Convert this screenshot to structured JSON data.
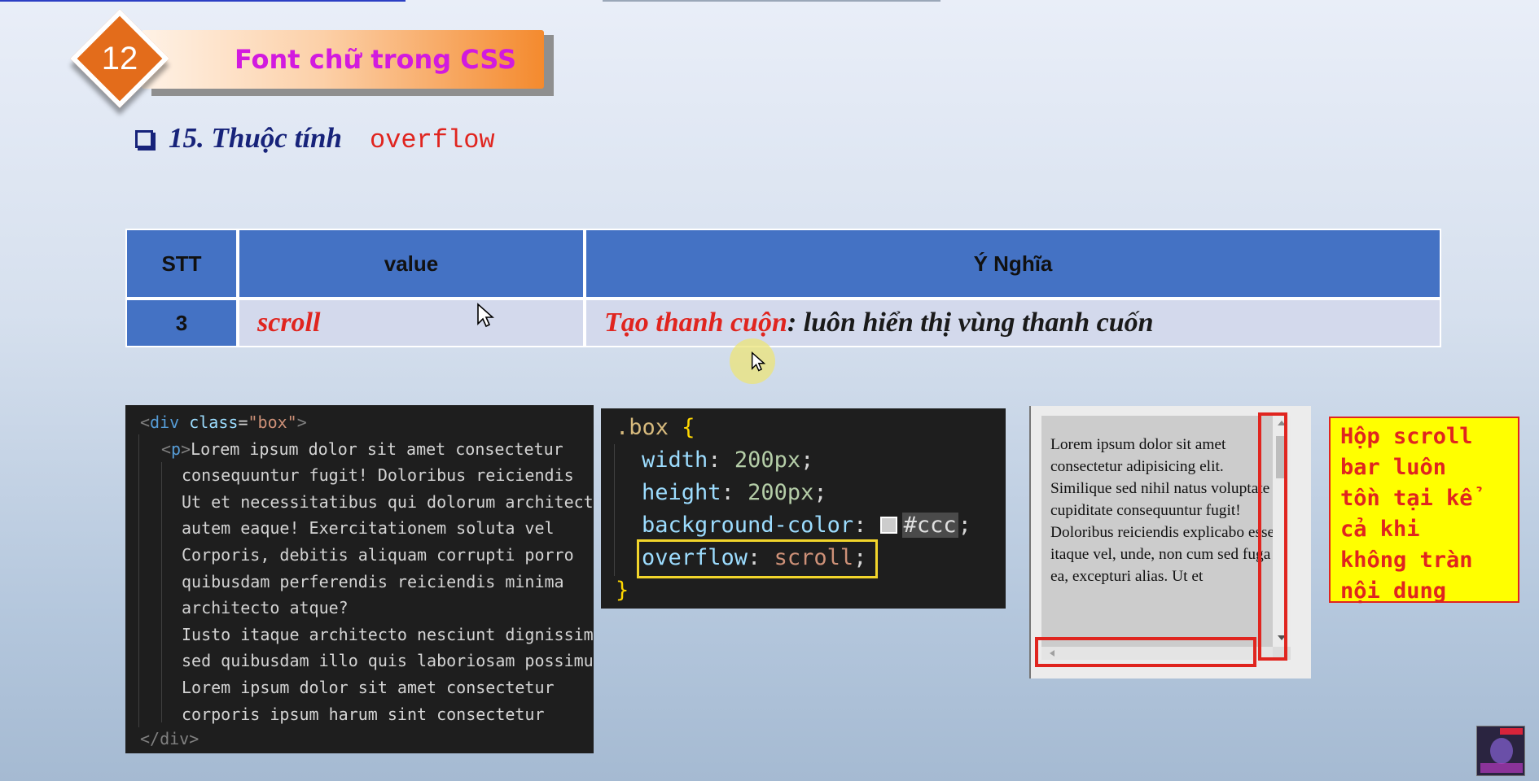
{
  "lesson": {
    "number": "12",
    "title": "Font chữ trong CSS"
  },
  "subheading": {
    "text": "15. Thuộc tính",
    "code": "overflow"
  },
  "table": {
    "headers": [
      "STT",
      "value",
      "Ý Nghĩa"
    ],
    "row": {
      "stt": "3",
      "value": "scroll",
      "meaning_highlight": "Tạo thanh cuộn",
      "meaning_rest": " : luôn hiển thị vùng thanh cuốn"
    }
  },
  "html_code": {
    "lines": [
      {
        "tag_open": "<",
        "tag": "div",
        "attr": "class",
        "eq": "=",
        "value": "\"box\"",
        "tag_close": ">"
      },
      {
        "tag_open": "<",
        "tag": "p",
        "tag_close": ">",
        "text": "Lorem ipsum dolor sit amet consectetur"
      },
      "consequuntur fugit! Doloribus reiciendis",
      "Ut et necessitatibus qui dolorum architecto",
      "autem eaque! Exercitationem soluta vel",
      "Corporis, debitis aliquam corrupti porro",
      "quibusdam perferendis reiciendis minima",
      "architecto atque?",
      "Iusto itaque architecto nesciunt dignissimos",
      "sed quibusdam illo quis laboriosam possimus",
      "Lorem ipsum dolor sit amet consectetur",
      "corporis ipsum harum sint consectetur"
    ],
    "closing": "</div>"
  },
  "css_code": {
    "selector": ".box",
    "open_brace": "{",
    "close_brace": "}",
    "decl1": {
      "prop": "width",
      "value": "200px"
    },
    "decl2": {
      "prop": "height",
      "value": "200px"
    },
    "decl3": {
      "prop": "background-color",
      "value": "#ccc"
    },
    "decl4": {
      "prop": "overflow",
      "value": "scroll"
    },
    "colon": ":",
    "semi": ";"
  },
  "demo": {
    "text": "Lorem ipsum dolor sit amet consectetur adipisicing elit. Similique sed nihil natus voluptate cupiditate consequuntur fugit! Doloribus reiciendis explicabo esse itaque vel, unde, non cum sed fuga ea, excepturi alias. Ut et"
  },
  "note": {
    "lines": [
      "Hộp scroll",
      "bar luôn",
      "tồn tại kể",
      "cả khi",
      "không tràn",
      "nội dung"
    ]
  },
  "colors": {
    "accent_orange": "#e36c1b",
    "table_blue": "#4472c4",
    "highlight_red": "#e0251f",
    "title_magenta": "#d21adf",
    "note_yellow": "#ffff00",
    "code_bg": "#1e1e1e"
  },
  "icons": [
    "checkbox-icon",
    "mouse-cursor-icon",
    "channel-avatar-icon"
  ]
}
